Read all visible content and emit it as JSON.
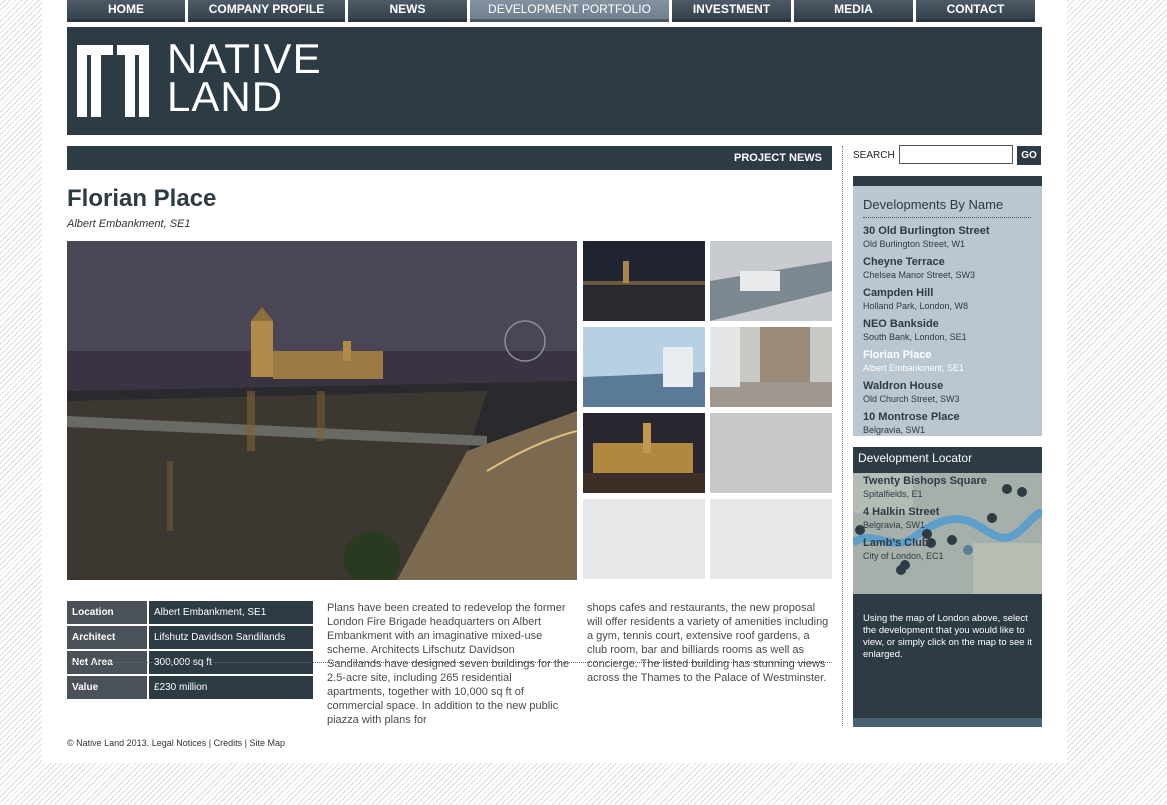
{
  "nav": [
    "Home",
    "Company Profile",
    "News",
    "Development Portfolio",
    "Investment",
    "Media",
    "Contact"
  ],
  "header": {
    "logo_line1": "NATIVE",
    "logo_line2": "LAND"
  },
  "project_news": "PROJECT NEWS",
  "project": {
    "title": "Florian Place",
    "location": "Albert Embankment, SE1"
  },
  "details": [
    {
      "label": "Location",
      "value": "Albert Embankment, SE1"
    },
    {
      "label": "Architect",
      "value": "Lifshutz Davidson Sandilands"
    },
    {
      "label": "Net Area",
      "value": "300,000 sq ft"
    },
    {
      "label": "Value",
      "value": "£230 million"
    }
  ],
  "description": {
    "col1": "Plans have been created to redevelop the former London Fire Brigade headquarters on Albert Embankment with an imaginative mixed-use scheme. Architects Lifschutz Davidson Sandilands have designed seven buildings for the 2.5-acre site, including 265 residential apartments, together with 10,000 sq ft of commercial space. In addition to the new public piazza with plans for",
    "col2": "shops cafes and restaurants, the new proposal will offer residents a variety of amenities including a gym, tennis court, extensive roof gardens, a club room, bar and billiards rooms as well as concierge. The listed building has stunning views across the Thames to the Palace of Westminster."
  },
  "footer": {
    "copyright": "© Native Land 2013.",
    "legal": "Legal Notices",
    "credits": "Credits",
    "sitemap": "Site Map",
    "sep": "|"
  },
  "search": {
    "label": "SEARCH",
    "value": "",
    "go": "GO"
  },
  "developments": {
    "heading": "Developments By Name",
    "items": [
      {
        "name": "30 Old Burlington Street",
        "address": "Old Burlington Street, W1"
      },
      {
        "name": "Cheyne Terrace",
        "address": "Chelsea Manor Street, SW3"
      },
      {
        "name": "Campden Hill",
        "address": "Holland Park, London, W8"
      },
      {
        "name": "NEO Bankside",
        "address": "South Bank, London, SE1"
      },
      {
        "name": "Florian Place",
        "address": "Albert Embankment, SE1"
      },
      {
        "name": "Waldron House",
        "address": "Old Church Street, SW3"
      },
      {
        "name": "10 Montrose Place",
        "address": "Belgravia, SW1"
      }
    ]
  },
  "locator": {
    "heading": "Development Locator",
    "labels": [
      {
        "name": "Twenty Bishops Square",
        "address": "Spitalfields, E1"
      },
      {
        "name": "4 Halkin Street",
        "address": "Belgravia, SW1"
      },
      {
        "name": "Lamb's Club",
        "address": "City of London, EC1"
      }
    ],
    "instructions": "Using the map of London above, select the development that you would like to view, or simply click on the map to see it enlarged."
  },
  "colors": {
    "dark": "#2d3b45",
    "panel": "#bac6d0",
    "active_nav": "#7a8a97"
  }
}
